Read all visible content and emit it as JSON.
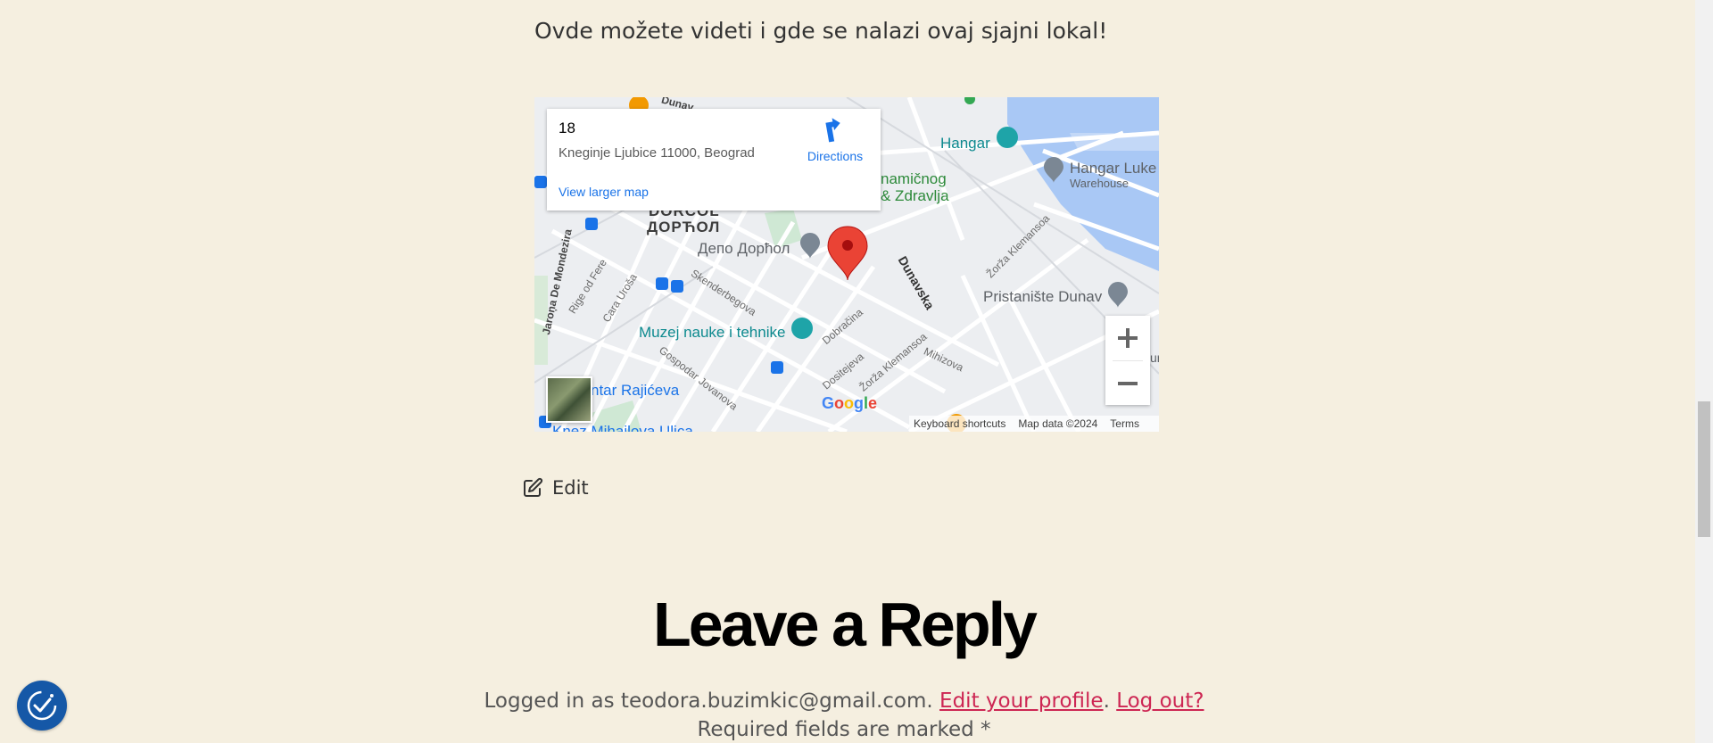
{
  "intro_text": "Ovde možete videti i gde se nalazi ovaj sjajni lokal!",
  "map": {
    "place_name": "18",
    "address": "Kneginje Ljubice 11000, Beograd",
    "directions_label": "Directions",
    "view_larger_label": "View larger map",
    "labels": {
      "hangar": "Hangar",
      "hangar_luke": "Hangar Luke",
      "warehouse": "Warehouse",
      "dinamicno": "namičnog",
      "zdravlja": "& Zdravlja",
      "dorcol_lat": "DORĆOL",
      "dorcol_cyr": "ДОРЋОЛ",
      "depo": "Депо Дорћол",
      "pristaniste": "Pristanište Dunav",
      "muzej": "Muzej nauke i tehnike",
      "rajiceva": "ntar Rajićeva",
      "knez": "Knez Mihailova Ulica",
      "dunavska": "Dunavska",
      "skenderbegova": "Skenderbegova",
      "cara_uros": "Cara Uroša",
      "rige_od_fere": "Rige od Fere",
      "jarona": "Jaroņa De Mondezira",
      "gospodar": "Gospodar Jovanova",
      "dobracina": "Dobračina",
      "dositejeva": "Dositejeva",
      "zorza1": "Žorža Klemansoa",
      "zorza2": "Žorža Klemansoa",
      "mihizova": "Mihizova",
      "dunav_top": "Dunav",
      "ru": "ur"
    },
    "keyboard_shortcuts": "Keyboard shortcuts",
    "map_data": "Map data ©2024",
    "terms": "Terms",
    "google": "Google"
  },
  "edit_label": "Edit",
  "reply": {
    "heading": "Leave a Reply",
    "logged_prefix": "Logged in as teodora.buzimkic@gmail.com.",
    "edit_profile": "Edit your profile",
    "logout": "Log out?",
    "required": "Required fields are marked *"
  },
  "colors": {
    "background": "#f5efe0",
    "link": "#cd2653",
    "map_blue": "#1a73e8",
    "pin_red": "#ea4335"
  }
}
